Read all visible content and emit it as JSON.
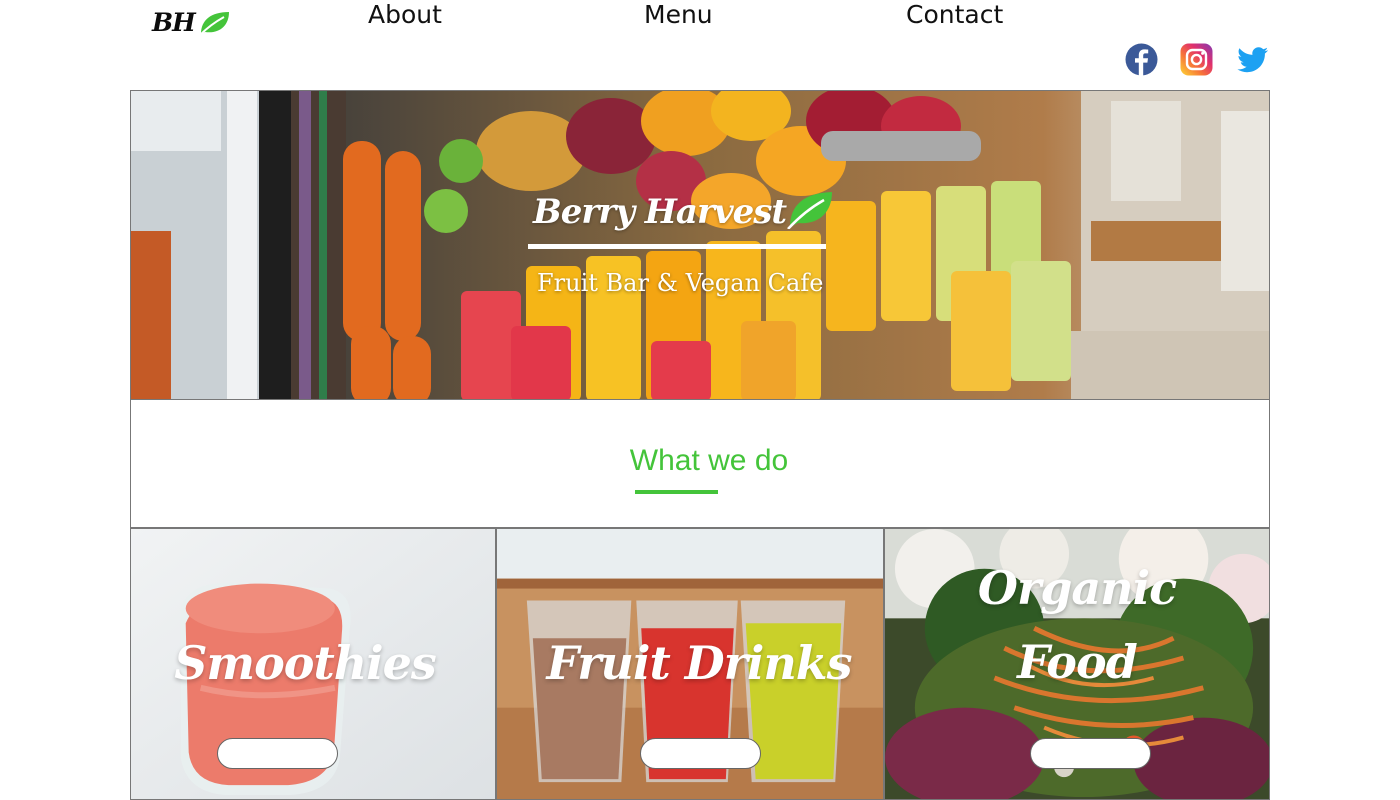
{
  "brand": {
    "logo_text": "BH",
    "logo_icon": "leaf-icon",
    "accent_color": "#44c43a"
  },
  "nav": {
    "items": [
      {
        "label": "About"
      },
      {
        "label": "Menu"
      },
      {
        "label": "Contact"
      }
    ]
  },
  "social": [
    {
      "icon": "facebook-icon",
      "color": "#3b5998"
    },
    {
      "icon": "instagram-icon",
      "color": "#e1306c"
    },
    {
      "icon": "twitter-icon",
      "color": "#1da1f2"
    }
  ],
  "hero": {
    "title": "Berry Harvest",
    "subtitle": "Fruit Bar & Vegan Cafe",
    "title_icon": "leaf-icon"
  },
  "section": {
    "title": "What we do"
  },
  "cards": [
    {
      "title": "Smoothies",
      "button_label": ""
    },
    {
      "title": "Fruit Drinks",
      "button_label": ""
    },
    {
      "title": "Organic Food",
      "title_line1": "Organic",
      "title_line2": "Food",
      "button_label": ""
    }
  ]
}
